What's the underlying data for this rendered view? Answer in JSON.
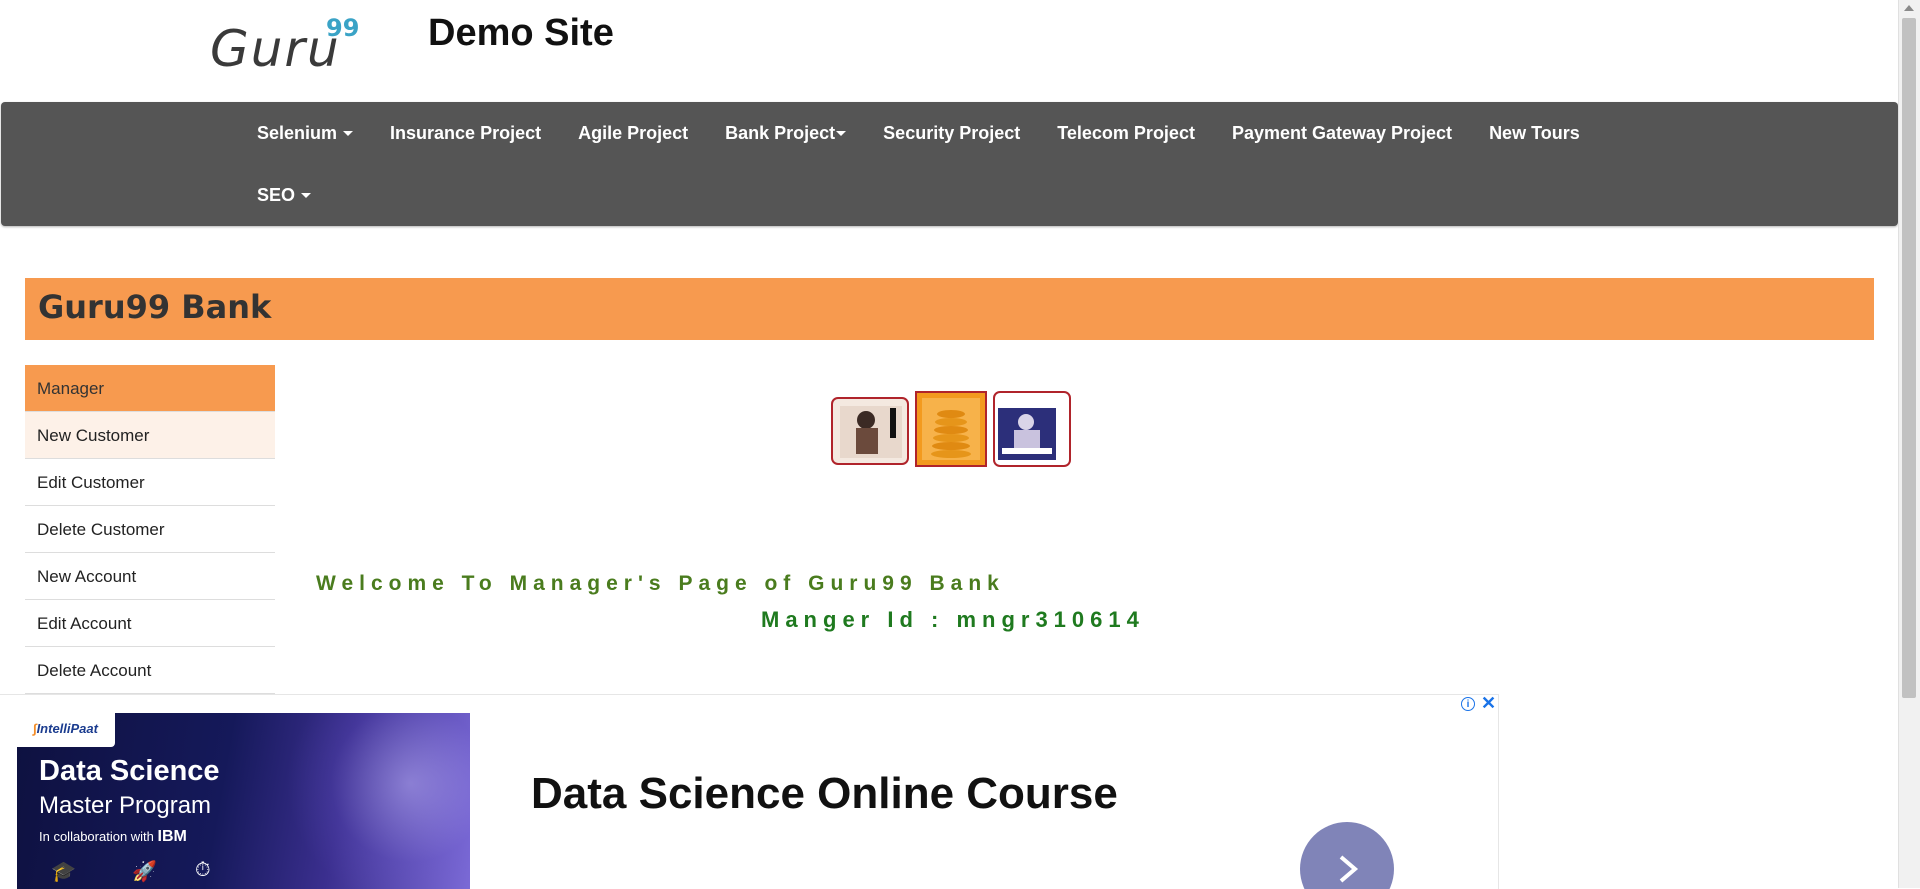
{
  "header": {
    "logo_text": "Guru",
    "logo_superscript": "99",
    "site_title": "Demo Site"
  },
  "navbar": {
    "row1": [
      {
        "label": "Selenium",
        "dropdown": true
      },
      {
        "label": "Insurance Project",
        "dropdown": false
      },
      {
        "label": "Agile Project",
        "dropdown": false
      },
      {
        "label": "Bank Project",
        "dropdown": true
      },
      {
        "label": "Security Project",
        "dropdown": false
      },
      {
        "label": "Telecom Project",
        "dropdown": false
      },
      {
        "label": "Payment Gateway Project",
        "dropdown": false
      },
      {
        "label": "New Tours",
        "dropdown": false
      }
    ],
    "row2": [
      {
        "label": "SEO",
        "dropdown": true
      }
    ]
  },
  "bank": {
    "title": "Guru99 Bank"
  },
  "sidebar": {
    "items": [
      {
        "label": "Manager"
      },
      {
        "label": "New Customer"
      },
      {
        "label": "Edit Customer"
      },
      {
        "label": "Delete Customer"
      },
      {
        "label": "New Account"
      },
      {
        "label": "Edit Account"
      },
      {
        "label": "Delete Account"
      }
    ]
  },
  "main": {
    "welcome_text": "Welcome To Manager's Page of Guru99 Bank",
    "manager_id_text": "Manger Id : mngr310614"
  },
  "ad": {
    "brand": "IntelliPaat",
    "image_heading": "Data Science",
    "image_subheading": "Master Program",
    "collab_text": "In collaboration with",
    "collab_partner": "IBM",
    "title": "Data Science Online Course",
    "info_icon": "info-icon",
    "close_icon": "close-icon"
  },
  "colors": {
    "navbar_bg": "#555555",
    "accent_orange": "#f79a4f",
    "welcome_green": "#4a7c1e",
    "manager_id_green": "#1f7a1f"
  }
}
